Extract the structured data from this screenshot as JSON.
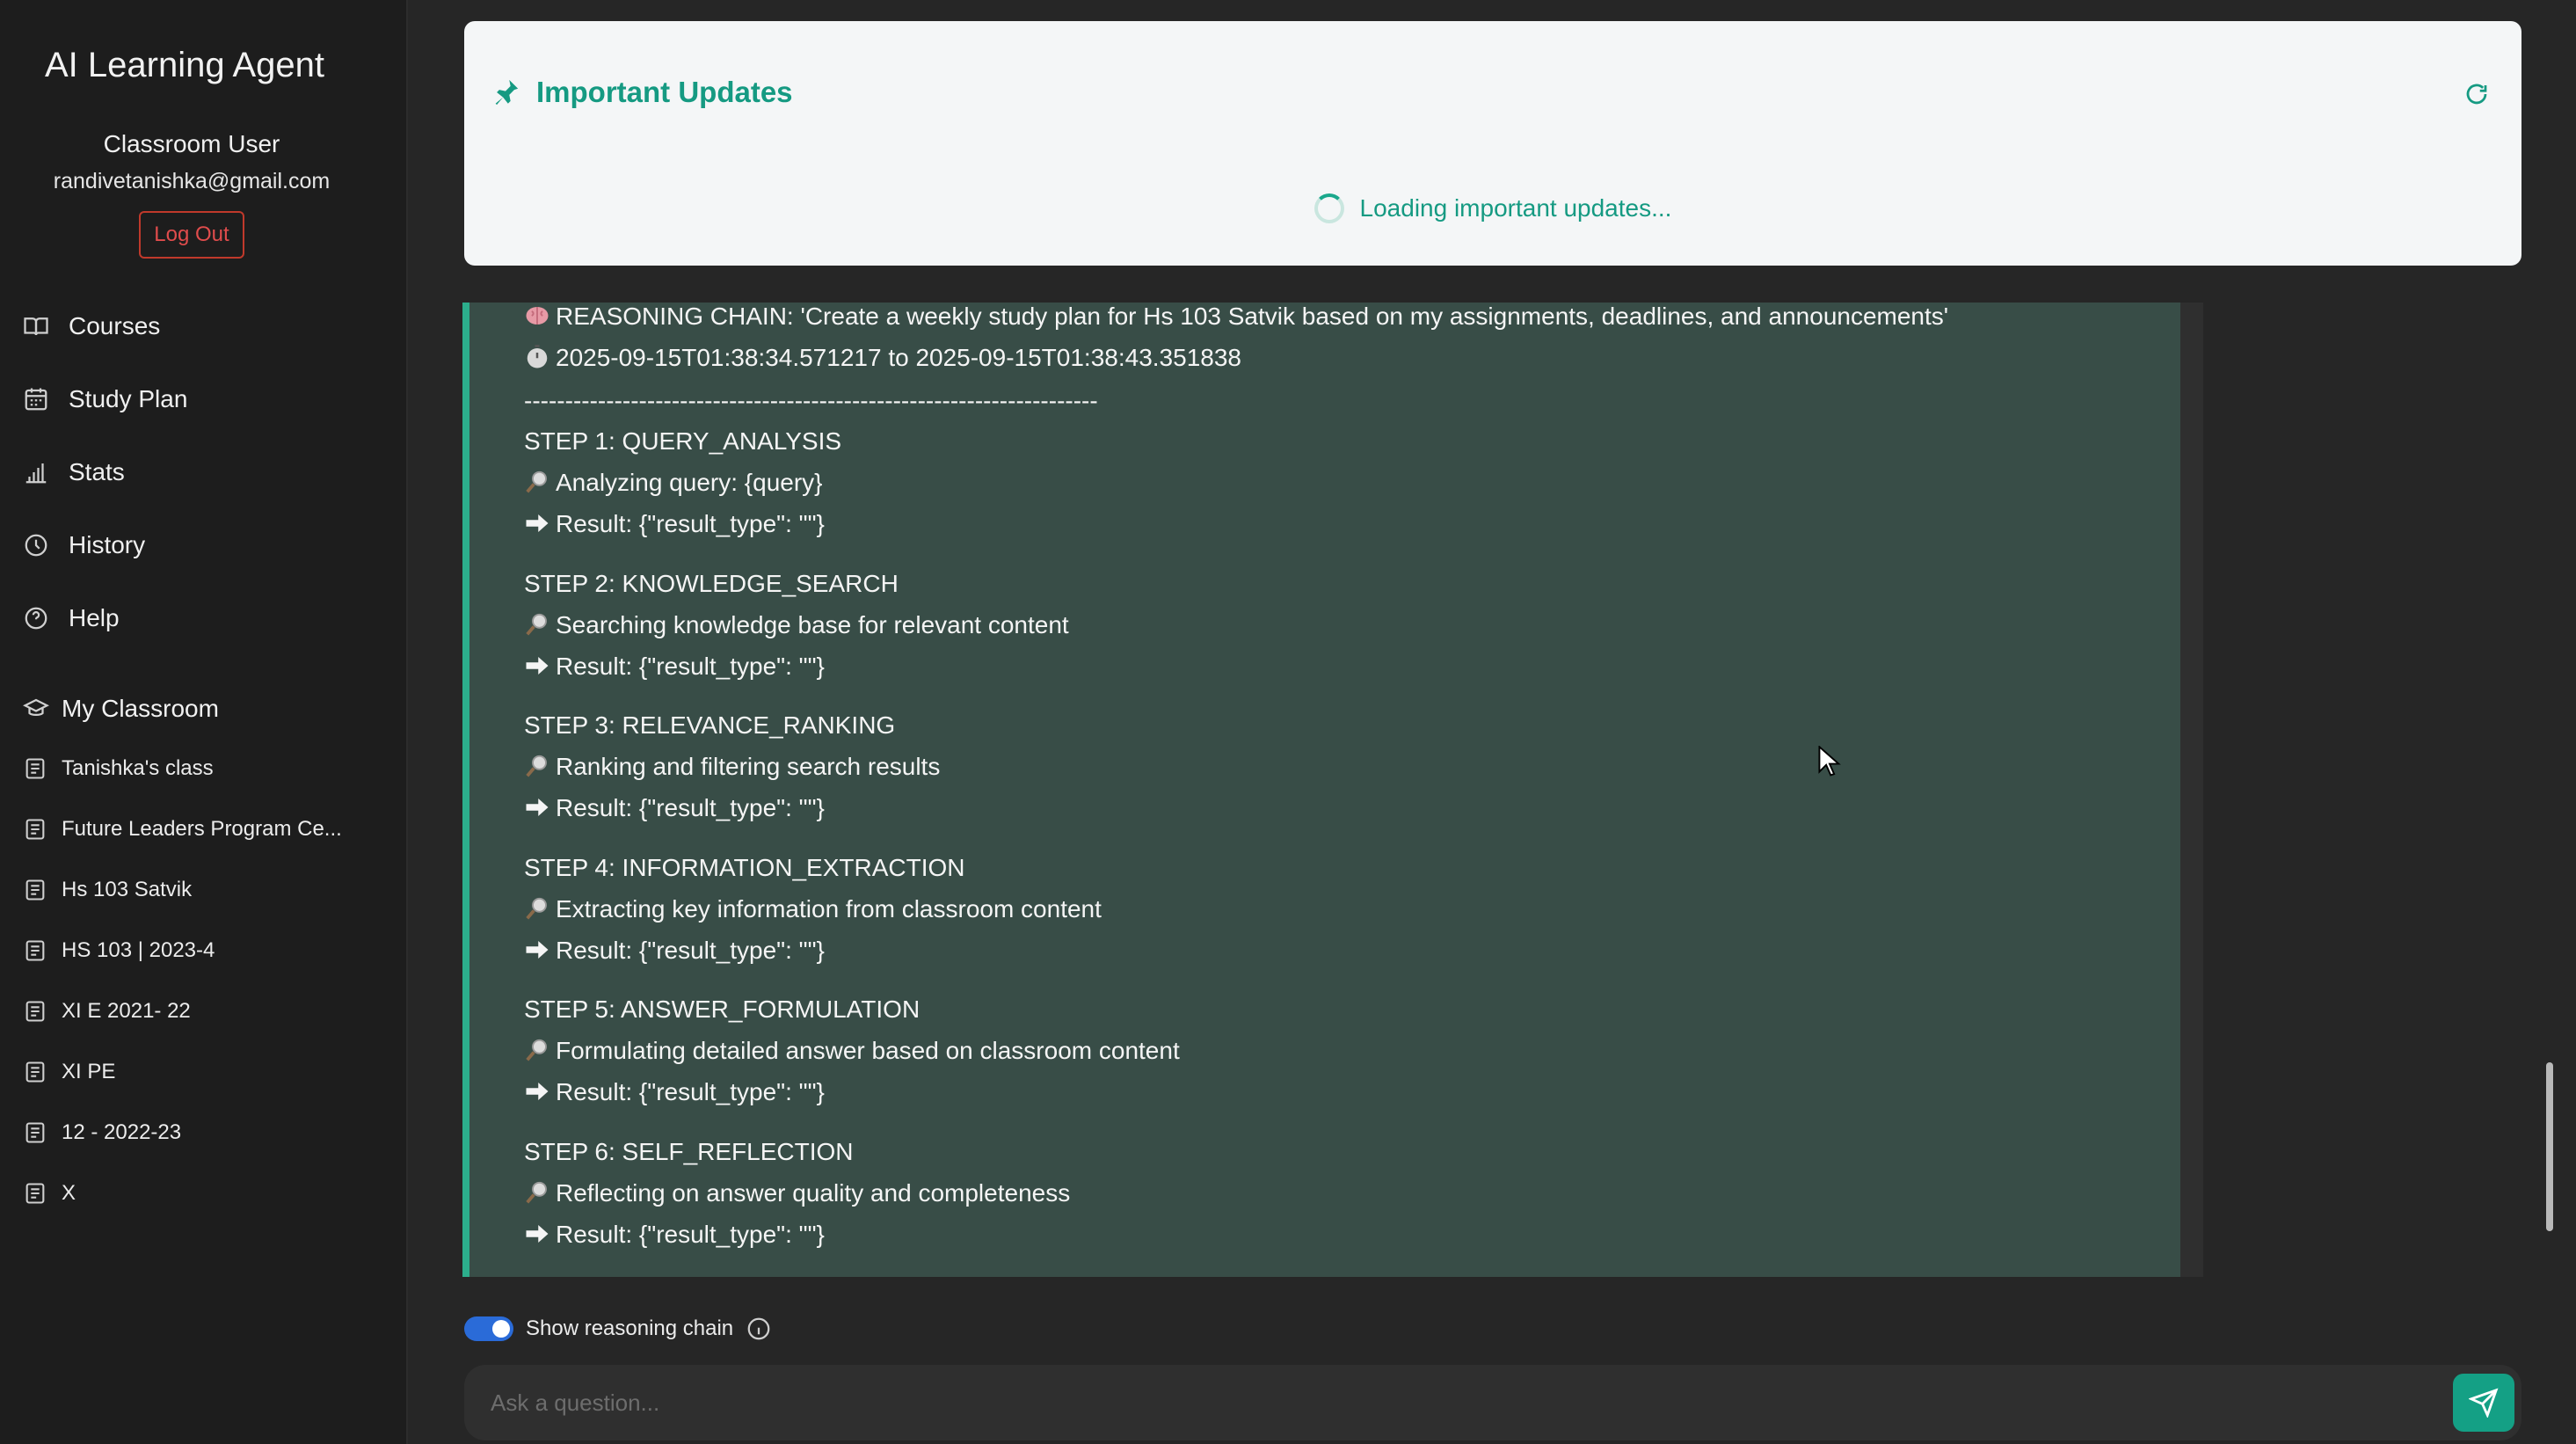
{
  "sidebar": {
    "app_title": "AI Learning Agent",
    "user_name": "Classroom User",
    "user_email": "randivetanishka@gmail.com",
    "logout_label": "Log Out",
    "nav": [
      {
        "label": "Courses",
        "icon": "book-icon"
      },
      {
        "label": "Study Plan",
        "icon": "calendar-icon"
      },
      {
        "label": "Stats",
        "icon": "bar-chart-icon"
      },
      {
        "label": "History",
        "icon": "clock-icon"
      },
      {
        "label": "Help",
        "icon": "help-circle-icon"
      }
    ],
    "classroom_header": "My Classroom",
    "classes": [
      {
        "label": "Tanishka's class"
      },
      {
        "label": "Future Leaders Program Ce..."
      },
      {
        "label": "Hs 103 Satvik"
      },
      {
        "label": "HS 103 | 2023-4"
      },
      {
        "label": "XI E 2021- 22"
      },
      {
        "label": "XI PE"
      },
      {
        "label": "12 - 2022-23"
      },
      {
        "label": "X"
      }
    ]
  },
  "updates": {
    "title": "Important Updates",
    "loading_text": "Loading important updates..."
  },
  "reasoning": {
    "header": "REASONING CHAIN: 'Create a weekly study plan for Hs 103 Satvik based on my assignments, deadlines, and announcements'",
    "time_range": "2025-09-15T01:38:34.571217 to 2025-09-15T01:38:43.351838",
    "separator": "----------------------------------------------------------------------",
    "steps": [
      {
        "title": "STEP 1: QUERY_ANALYSIS",
        "action": "Analyzing query: {query}",
        "result": "Result: {\"result_type\": \"\"}"
      },
      {
        "title": "STEP 2: KNOWLEDGE_SEARCH",
        "action": "Searching knowledge base for relevant content",
        "result": "Result: {\"result_type\": \"\"}"
      },
      {
        "title": "STEP 3: RELEVANCE_RANKING",
        "action": "Ranking and filtering search results",
        "result": "Result: {\"result_type\": \"\"}"
      },
      {
        "title": "STEP 4: INFORMATION_EXTRACTION",
        "action": "Extracting key information from classroom content",
        "result": "Result: {\"result_type\": \"\"}"
      },
      {
        "title": "STEP 5: ANSWER_FORMULATION",
        "action": "Formulating detailed answer based on classroom content",
        "result": "Result: {\"result_type\": \"\"}"
      },
      {
        "title": "STEP 6: SELF_REFLECTION",
        "action": "Reflecting on answer quality and completeness",
        "result": "Result: {\"result_type\": \"\"}"
      }
    ]
  },
  "controls": {
    "toggle_label": "Show reasoning chain",
    "ask_placeholder": "Ask a question..."
  },
  "colors": {
    "accent": "#159a82",
    "panel": "#384d47",
    "danger": "#e04c4c",
    "toggle": "#2a6bd8"
  }
}
